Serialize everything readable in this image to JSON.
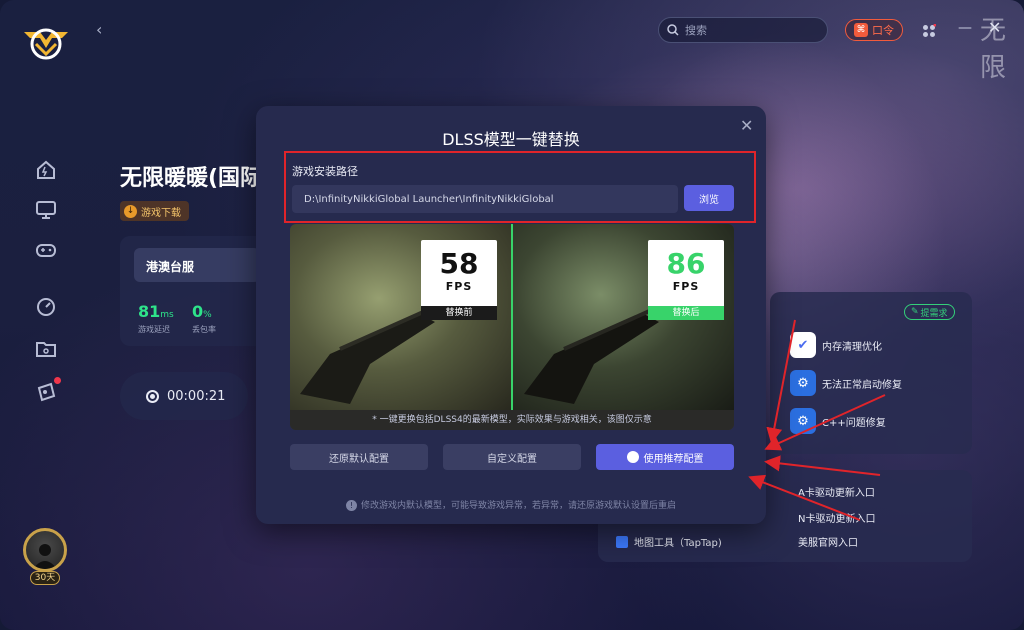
{
  "header": {
    "search_placeholder": "搜索",
    "kouling_label": "口令",
    "brand_corner": "无限"
  },
  "game": {
    "title": "无限暖暖(国际",
    "download_label": "游戏下载",
    "server_name": "港澳台服",
    "latency_value": "81",
    "latency_unit": "ms",
    "latency_label": "游戏延迟",
    "packet_loss_value": "0",
    "packet_loss_unit": "%",
    "packet_loss_label": "丢包率",
    "timer": "00:00:21"
  },
  "user": {
    "membership_days": "30天"
  },
  "tools": {
    "need_label": "提需求",
    "items": [
      {
        "label": "内存清理优化",
        "icon": "memory-clean-icon"
      },
      {
        "label": "无法正常启动修复",
        "icon": "startup-repair-icon"
      },
      {
        "label": "C++问题修复",
        "icon": "cpp-repair-icon"
      }
    ],
    "links": [
      {
        "label": "A卡驱动更新入口"
      },
      {
        "label": "N卡驱动更新入口"
      },
      {
        "label": "地图工具（TapTap)"
      },
      {
        "label": "美服官网入口"
      }
    ]
  },
  "modal": {
    "title": "DLSS模型一键替换",
    "path_label": "游戏安装路径",
    "path_value": "D:\\InfinityNikkiGlobal Launcher\\InfinityNikkiGlobal",
    "browse_label": "浏览",
    "before_fps": "58",
    "after_fps": "86",
    "fps_unit": "FPS",
    "before_tag": "替换前",
    "after_tag": "替换后",
    "caption": "* 一键更换包括DLSS4的最新模型，实际效果与游戏相关，该图仅示意",
    "restore_label": "还原默认配置",
    "custom_label": "自定义配置",
    "recommend_label": "使用推荐配置",
    "warning": "修改游戏内默认模型，可能导致游戏异常，若异常，请还原游戏默认设置后重启"
  },
  "colors": {
    "accent": "#5b5fe0",
    "highlight_red": "#e0242a",
    "fps_after_green": "#38d36a",
    "latency_green": "#2ee38a",
    "kouling_orange": "#f25b3c"
  }
}
